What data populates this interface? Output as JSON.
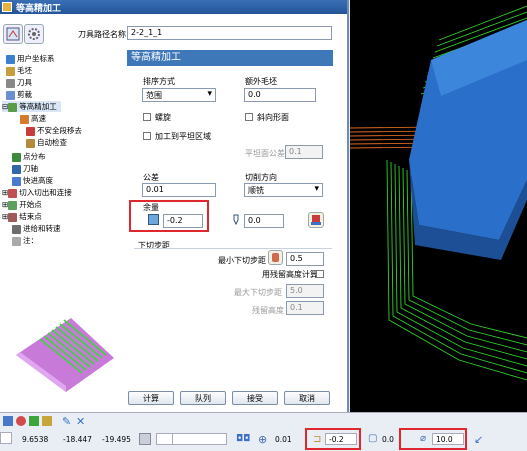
{
  "window": {
    "title": "等高精加工"
  },
  "toolpath_name": {
    "label": "刀具路径名称",
    "value": "2-2_1_1"
  },
  "tree": {
    "items": [
      {
        "label": "用户坐标系"
      },
      {
        "label": "毛坯"
      },
      {
        "label": "刀具"
      },
      {
        "label": "剪裁"
      },
      {
        "label": "等高精加工"
      },
      {
        "label": "高速"
      },
      {
        "label": "不安全段移去"
      },
      {
        "label": "自动检查"
      },
      {
        "label": "点分布"
      },
      {
        "label": "刀轴"
      },
      {
        "label": "快进高度"
      },
      {
        "label": "切入切出和连接"
      },
      {
        "label": "开始点"
      },
      {
        "label": "结束点"
      },
      {
        "label": "进给和转速"
      },
      {
        "label": "注："
      }
    ]
  },
  "panel": {
    "header": "等高精加工",
    "sort_label": "排序方式",
    "sort_value": "范围",
    "extra_stock_label": "额外毛坯",
    "extra_stock_value": "0.0",
    "spiral_label": "螺旋",
    "slope_label": "斜向形面",
    "flat_area_label": "加工到平坦区域",
    "flat_tol_label": "平坦面公差",
    "flat_tol_value": "0.1",
    "tolerance_label": "公差",
    "tolerance_value": "0.01",
    "cut_dir_label": "切削方向",
    "cut_dir_value": "顺铣",
    "stock_label": "余量",
    "stock_value": "-0.2",
    "axial_value": "0.0",
    "stepdown_header": "下切步距",
    "min_stepdown_label": "最小下切步距",
    "min_stepdown_value": "0.5",
    "residual_label": "用残留高度计算",
    "max_stepdown_label": "最大下切步距",
    "max_stepdown_value": "5.0",
    "cusp_label": "残留高度",
    "cusp_value": "0.1"
  },
  "buttons": {
    "calc": "计算",
    "queue": "队列",
    "accept": "接受",
    "cancel": "取消"
  },
  "status": {
    "x": "9.6538",
    "y": "-18.447",
    "z": "-19.495",
    "tol": "0.01",
    "radial_stock": "-0.2",
    "axial_stock": "0.0",
    "diameter": "10.0"
  },
  "colors": {
    "title_bar": "#2a5ca3",
    "panel_header": "#3f78b8",
    "highlight": "#e0272d",
    "viewport_bg": "#000000",
    "toolpath_green": "#2fd42a",
    "part_blue": "#2a6fc9",
    "toolpath_orange": "#d96a1e"
  }
}
